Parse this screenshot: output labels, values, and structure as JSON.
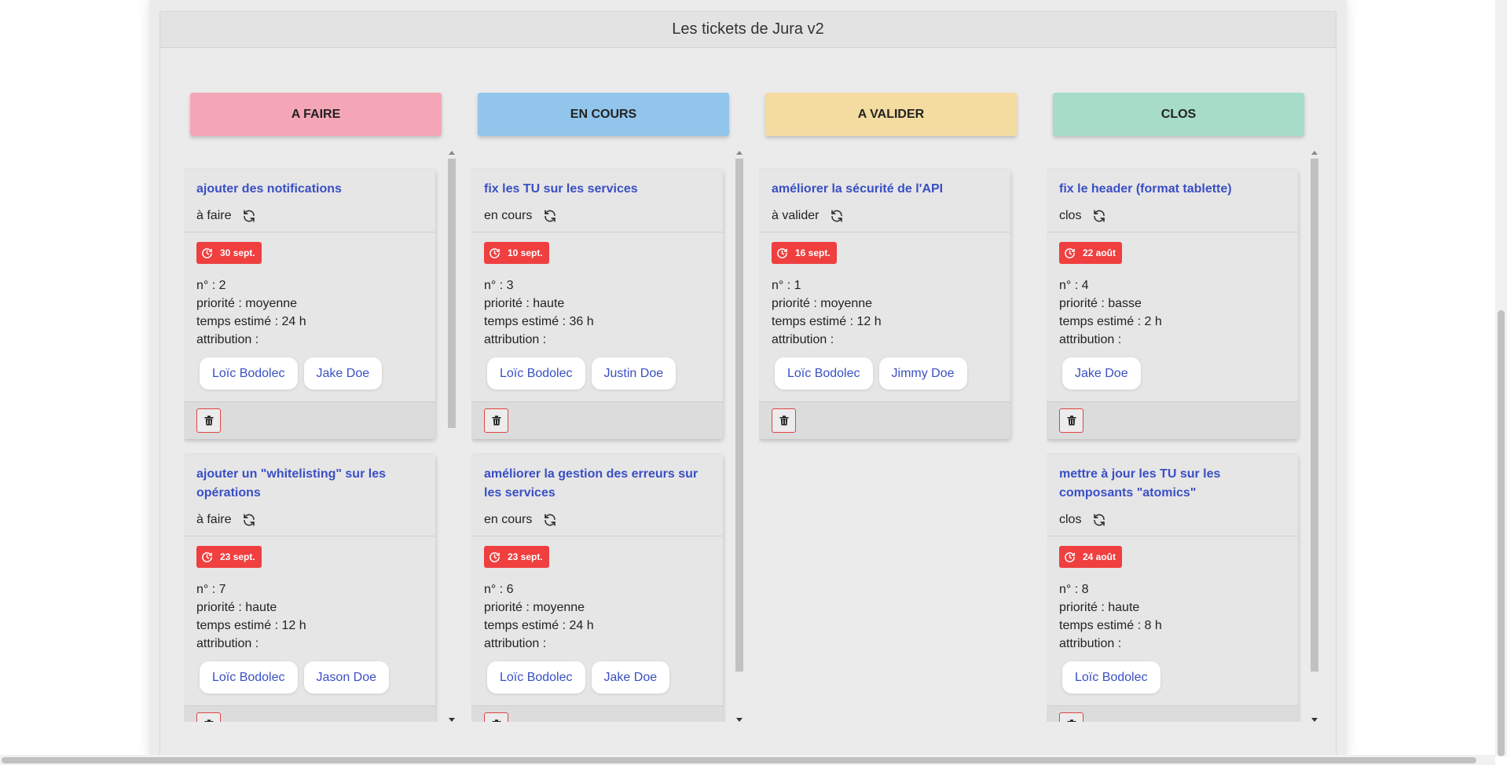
{
  "board": {
    "title": "Les tickets de Jura v2"
  },
  "colors": {
    "todo": "#f5a6b6",
    "in_progress": "#92c5eb",
    "to_validate": "#f4dca0",
    "closed": "#a6dcc8",
    "badge": "#ef3f3f",
    "link": "#3a4fc4"
  },
  "columns": [
    {
      "label": "A FAIRE",
      "cards": [
        {
          "title": "ajouter des notifications",
          "status": "à faire",
          "date": "30 sept.",
          "number": "n° : 2",
          "priority": "priorité : moyenne",
          "estimate": "temps estimé : 24 h",
          "attribution": "attribution :",
          "users": [
            "Loïc Bodolec",
            "Jake Doe"
          ]
        },
        {
          "title": "ajouter un \"whitelisting\" sur les opérations",
          "status": "à faire",
          "date": "23 sept.",
          "number": "n° : 7",
          "priority": "priorité : haute",
          "estimate": "temps estimé : 12 h",
          "attribution": "attribution :",
          "users": [
            "Loïc Bodolec",
            "Jason Doe"
          ]
        }
      ]
    },
    {
      "label": "EN COURS",
      "cards": [
        {
          "title": "fix les TU sur les services",
          "status": "en cours",
          "date": "10 sept.",
          "number": "n° : 3",
          "priority": "priorité : haute",
          "estimate": "temps estimé : 36 h",
          "attribution": "attribution :",
          "users": [
            "Loïc Bodolec",
            "Justin Doe"
          ]
        },
        {
          "title": "améliorer la gestion des erreurs sur les services",
          "status": "en cours",
          "date": "23 sept.",
          "number": "n° : 6",
          "priority": "priorité : moyenne",
          "estimate": "temps estimé : 24 h",
          "attribution": "attribution :",
          "users": [
            "Loïc Bodolec",
            "Jake Doe"
          ]
        }
      ]
    },
    {
      "label": "A VALIDER",
      "cards": [
        {
          "title": "améliorer la sécurité de l'API",
          "status": "à valider",
          "date": "16 sept.",
          "number": "n° : 1",
          "priority": "priorité : moyenne",
          "estimate": "temps estimé : 12 h",
          "attribution": "attribution :",
          "users": [
            "Loïc Bodolec",
            "Jimmy Doe"
          ]
        }
      ]
    },
    {
      "label": "CLOS",
      "cards": [
        {
          "title": "fix le header (format tablette)",
          "status": "clos",
          "date": "22 août",
          "number": "n° : 4",
          "priority": "priorité : basse",
          "estimate": "temps estimé : 2 h",
          "attribution": "attribution :",
          "users": [
            "Jake Doe"
          ]
        },
        {
          "title": "mettre à jour les TU sur les composants \"atomics\"",
          "status": "clos",
          "date": "24 août",
          "number": "n° : 8",
          "priority": "priorité : haute",
          "estimate": "temps estimé : 8 h",
          "attribution": "attribution :",
          "users": [
            "Loïc Bodolec"
          ]
        }
      ]
    }
  ]
}
